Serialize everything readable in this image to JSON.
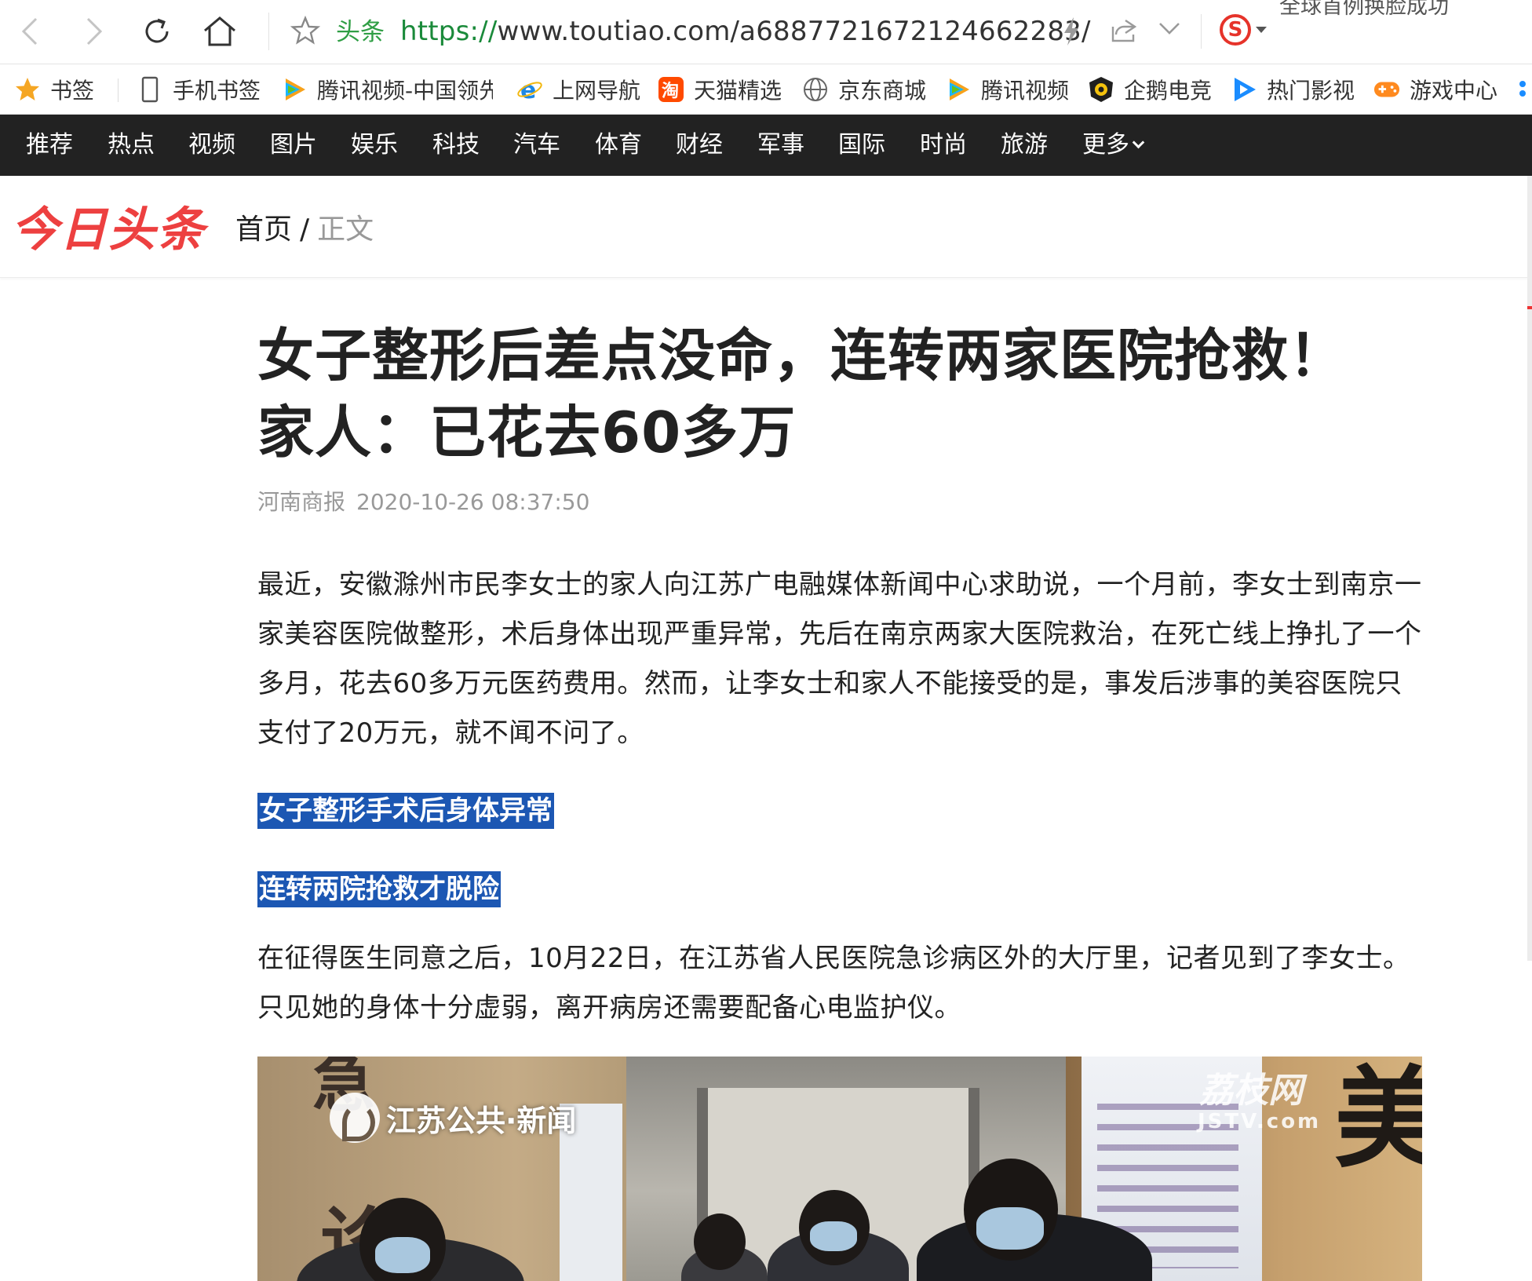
{
  "browser": {
    "url_site_label": "头条",
    "url_scheme": "https://",
    "url_rest": "www.toutiao.com/a6887721672124662283/",
    "top_hint": "全球首例换脸成功"
  },
  "bookmarks": [
    {
      "label": "书签",
      "icon": "star-icon"
    },
    {
      "label": "手机书签",
      "icon": "phone-icon"
    },
    {
      "label": "腾讯视频-中国领先",
      "icon": "tencent-video-icon"
    },
    {
      "label": "上网导航",
      "icon": "ie-icon"
    },
    {
      "label": "天猫精选",
      "icon": "taobao-icon"
    },
    {
      "label": "京东商城",
      "icon": "globe-icon"
    },
    {
      "label": "腾讯视频",
      "icon": "tencent-video-icon"
    },
    {
      "label": "企鹅电竞",
      "icon": "penguin-esports-icon"
    },
    {
      "label": "热门影视",
      "icon": "play-icon"
    },
    {
      "label": "游戏中心",
      "icon": "gamepad-icon"
    }
  ],
  "nav": [
    "推荐",
    "热点",
    "视频",
    "图片",
    "娱乐",
    "科技",
    "汽车",
    "体育",
    "财经",
    "军事",
    "国际",
    "时尚",
    "旅游",
    "更多"
  ],
  "header": {
    "logo": "今日头条",
    "breadcrumb_home": "首页",
    "breadcrumb_sep": "/",
    "breadcrumb_current": "正文"
  },
  "article": {
    "title_line1": "女子整形后差点没命，连转两家医院抢救！",
    "title_line2": "家人：已花去60多万",
    "source": "河南商报",
    "time": "2020-10-26 08:37:50",
    "para1": "最近，安徽滁州市民李女士的家人向江苏广电融媒体新闻中心求助说，一个月前，李女士到南京一家美容医院做整形，术后身体出现严重异常，先后在南京两家大医院救治，在死亡线上挣扎了一个多月，花去60多万元医药费用。然而，让李女士和家人不能接受的是，事发后涉事的美容医院只支付了20万元，就不闻不问了。",
    "highlight1": "女子整形手术后身体异常",
    "highlight2": "连转两院抢救才脱险",
    "para2": "在征得医生同意之后，10月22日，在江苏省人民医院急诊病区外的大厅里，记者见到了李女士。只见她的身体十分虚弱，离开病房还需要配备心电监护仪。"
  },
  "media": {
    "watermark_left": "江苏公共·新闻",
    "watermark_right": "荔枝网",
    "watermark_right_sub": "JSTV.com",
    "scene_char_right": "美",
    "scene_char_left1": "急",
    "scene_char_left2": "诊"
  },
  "colors": {
    "nav_bg": "#222222",
    "logo_red": "#ed4040",
    "highlight_bg": "#1c57b3",
    "url_green": "#1a8a3a"
  }
}
